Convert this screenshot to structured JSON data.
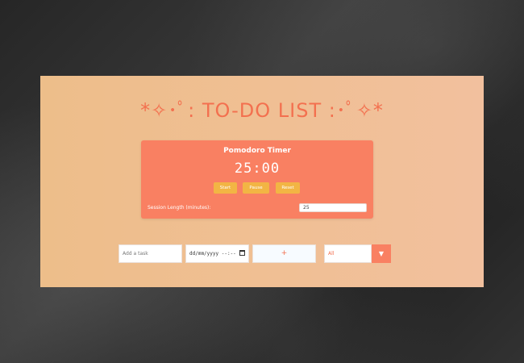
{
  "page": {
    "title": "*✧･ﾟ: TO-DO LIST :･ﾟ✧*"
  },
  "pomodoro": {
    "title": "Pomodoro Timer",
    "time": "25:00",
    "start_label": "Start",
    "pause_label": "Pause",
    "reset_label": "Reset",
    "session_label": "Session Length (minutes):",
    "session_value": "25"
  },
  "task_form": {
    "task_placeholder": "Add a task",
    "date_placeholder": "dd/mm/yyyy --:--",
    "add_icon": "plus-icon",
    "add_glyph": "+"
  },
  "filter": {
    "selected": "All",
    "arrow_glyph": "▼"
  },
  "colors": {
    "accent": "#f3704f",
    "pomodoro_bg": "#f98062",
    "button_bg": "#f2b544",
    "card_bg_start": "#edbe8a",
    "card_bg_end": "#f2c09e"
  }
}
